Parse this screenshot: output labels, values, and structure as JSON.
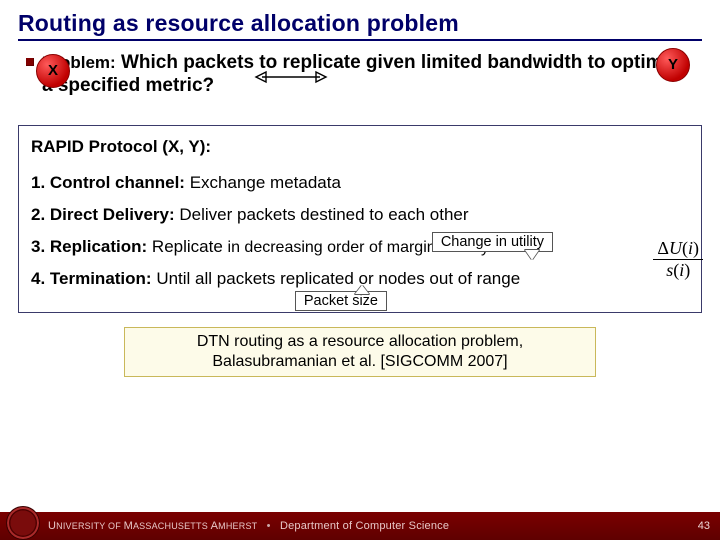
{
  "title": "Routing as resource allocation problem",
  "problem": {
    "label": "Problem:",
    "text": "Which packets to replicate given limited bandwidth to optimize a specified metric?"
  },
  "nodes": {
    "x": "X",
    "y": "Y"
  },
  "protocol": {
    "heading": "RAPID Protocol (X, Y):",
    "steps": {
      "s1": {
        "label": "1. Control channel:",
        "text": "Exchange metadata"
      },
      "s2": {
        "label": "2. Direct Delivery:",
        "text": "Deliver packets destined to each other"
      },
      "s3": {
        "label": "3. Replication:",
        "text_a": "Replicate",
        "text_b": "in decreasing order of marginal utility"
      },
      "s4": {
        "label": "4. Termination:",
        "text": "Until all packets replicated or nodes out of range"
      }
    },
    "callouts": {
      "change_in_utility": "Change in utility",
      "packet_size": "Packet size"
    },
    "formula": {
      "numerator": "ΔU(i)",
      "denominator": "s(i)"
    }
  },
  "citation": {
    "line1": "DTN routing as a resource allocation problem,",
    "line2": "Balasubramanian et al. [SIGCOMM 2007]"
  },
  "footer": {
    "university_prefix": "U",
    "university_rest": "NIVERSITY OF ",
    "mass_prefix": "M",
    "mass_rest": "ASSACHUSETTS ",
    "amherst_prefix": "A",
    "amherst_rest": "MHERST",
    "separator": "•",
    "department": "Department of Computer Science",
    "page": "43"
  }
}
